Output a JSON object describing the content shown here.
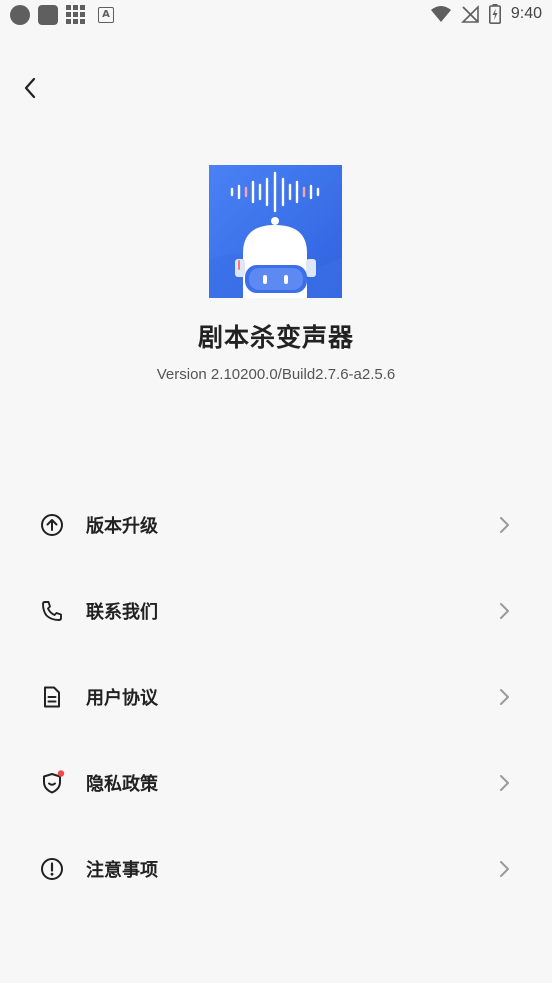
{
  "status_bar": {
    "time": "9:40",
    "left_icons": [
      "circle-notification-icon",
      "square-notification-icon",
      "grid-notification-icon",
      "a-notification-icon"
    ],
    "right_icons": [
      "wifi-icon",
      "no-signal-icon",
      "battery-charging-icon"
    ],
    "a_label": "A"
  },
  "header": {
    "back_icon": "chevron-left-icon"
  },
  "app": {
    "name": "剧本杀变声器",
    "version": "Version 2.10200.0/Build2.7.6-a2.5.6",
    "logo_color": "#3d73ee"
  },
  "menu": {
    "items": [
      {
        "label": "版本升级",
        "icon": "upgrade-icon"
      },
      {
        "label": "联系我们",
        "icon": "phone-icon"
      },
      {
        "label": "用户协议",
        "icon": "document-icon"
      },
      {
        "label": "隐私政策",
        "icon": "shield-icon"
      },
      {
        "label": "注意事项",
        "icon": "warning-icon"
      }
    ]
  },
  "colors": {
    "background": "#f7f7f7",
    "badge_red": "#f04848",
    "text_primary": "#222222",
    "text_secondary": "#555555",
    "chevron": "#9a9a9a"
  }
}
